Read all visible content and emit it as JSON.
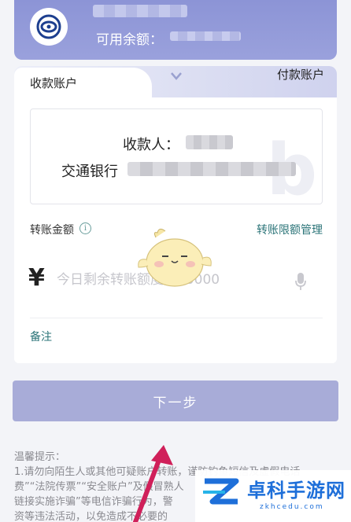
{
  "account": {
    "balance_label": "可用余额："
  },
  "tabs": {
    "receive": "收款账户",
    "pay": "付款账户"
  },
  "payee": {
    "name_label": "收款人：",
    "bank_name": "交通银行"
  },
  "amount": {
    "label": "转账金额",
    "limit_link": "转账限额管理",
    "currency_symbol": "¥",
    "placeholder": "今日剩余转账额度：50000"
  },
  "remark_label": "备注",
  "next_button": "下一步",
  "tips": {
    "title": "温馨提示：",
    "line1": "1.请勿向陌生人或其他可疑账户转账，谨防钓鱼短信及虚假电话",
    "line2": "费”“法院传票”“安全账户”及假冒熟人",
    "line3": "链接实施诈骗”等电信诈骗行为，警",
    "line4": "资等违法活动，以免造成不必要的"
  },
  "brand": {
    "name": "卓科手游网",
    "url": "zkhcedu.com"
  },
  "colors": {
    "accent": "#2b7478",
    "card_purple": "#8c94d6",
    "button": "#a8acd8"
  }
}
